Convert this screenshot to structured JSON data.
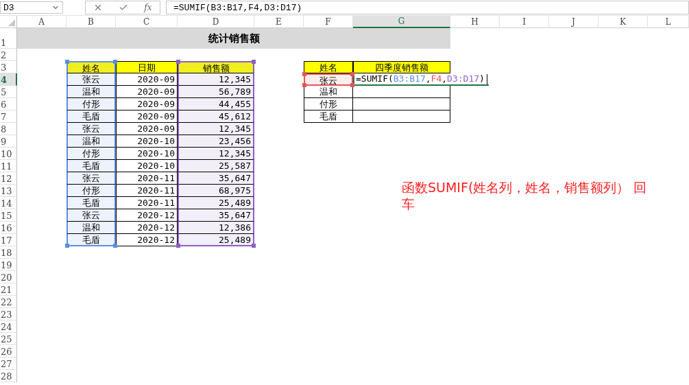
{
  "formula_bar": {
    "name_box": "D3",
    "function_label": "fx",
    "formula": "=SUMIF(B3:B17,F4,D3:D17)"
  },
  "columns": [
    {
      "label": "A",
      "selected": false
    },
    {
      "label": "B",
      "selected": false
    },
    {
      "label": "C",
      "selected": false
    },
    {
      "label": "D",
      "selected": false
    },
    {
      "label": "E",
      "selected": false
    },
    {
      "label": "F",
      "selected": false
    },
    {
      "label": "G",
      "selected": true
    },
    {
      "label": "H",
      "selected": false
    },
    {
      "label": "I",
      "selected": false
    },
    {
      "label": "J",
      "selected": false
    },
    {
      "label": "K",
      "selected": false
    },
    {
      "label": "L",
      "selected": false
    }
  ],
  "rows": [
    {
      "label": "1",
      "selected": false
    },
    {
      "label": "2",
      "selected": false
    },
    {
      "label": "3",
      "selected": false
    },
    {
      "label": "4",
      "selected": true
    },
    {
      "label": "5",
      "selected": false
    },
    {
      "label": "6",
      "selected": false
    },
    {
      "label": "7",
      "selected": false
    },
    {
      "label": "8",
      "selected": false
    },
    {
      "label": "9",
      "selected": false
    },
    {
      "label": "10",
      "selected": false
    },
    {
      "label": "11",
      "selected": false
    },
    {
      "label": "12",
      "selected": false
    },
    {
      "label": "13",
      "selected": false
    },
    {
      "label": "14",
      "selected": false
    },
    {
      "label": "15",
      "selected": false
    },
    {
      "label": "16",
      "selected": false
    },
    {
      "label": "17",
      "selected": false
    },
    {
      "label": "18",
      "selected": false
    },
    {
      "label": "19",
      "selected": false
    },
    {
      "label": "20",
      "selected": false
    },
    {
      "label": "21",
      "selected": false
    },
    {
      "label": "22",
      "selected": false
    },
    {
      "label": "23",
      "selected": false
    },
    {
      "label": "24",
      "selected": false
    },
    {
      "label": "25",
      "selected": false
    },
    {
      "label": "26",
      "selected": false
    },
    {
      "label": "27",
      "selected": false
    },
    {
      "label": "28",
      "selected": false
    }
  ],
  "title": "统计销售额",
  "sales_table": {
    "columns": [
      "姓名",
      "日期",
      "销售额"
    ],
    "rows": [
      [
        "张云",
        "2020-09",
        "12,345"
      ],
      [
        "温和",
        "2020-09",
        "56,789"
      ],
      [
        "付形",
        "2020-09",
        "44,455"
      ],
      [
        "毛盾",
        "2020-09",
        "45,612"
      ],
      [
        "张云",
        "2020-09",
        "12,345"
      ],
      [
        "温和",
        "2020-10",
        "23,456"
      ],
      [
        "付形",
        "2020-10",
        "12,345"
      ],
      [
        "毛盾",
        "2020-10",
        "25,587"
      ],
      [
        "张云",
        "2020-11",
        "35,647"
      ],
      [
        "付形",
        "2020-11",
        "68,975"
      ],
      [
        "毛盾",
        "2020-11",
        "25,489"
      ],
      [
        "张云",
        "2020-12",
        "35,647"
      ],
      [
        "温和",
        "2020-12",
        "12,386"
      ],
      [
        "毛盾",
        "2020-12",
        "25,489"
      ]
    ]
  },
  "summary_table": {
    "columns": [
      "姓名",
      "四季度销售额"
    ],
    "rows": [
      "张云",
      "温和",
      "付形",
      "毛盾"
    ],
    "editor": [
      {
        "text": "=SUMIF("
      },
      {
        "text": "B3:B17",
        "color": "#5b8ee6"
      },
      {
        "text": ","
      },
      {
        "text": "F4",
        "color": "#e8545a"
      },
      {
        "text": ","
      },
      {
        "text": "D3:D17",
        "color": "#8e5fc7"
      },
      {
        "text": ")"
      }
    ]
  },
  "note": "函数SUMIF(姓名列，姓名，销售额列） 回车"
}
